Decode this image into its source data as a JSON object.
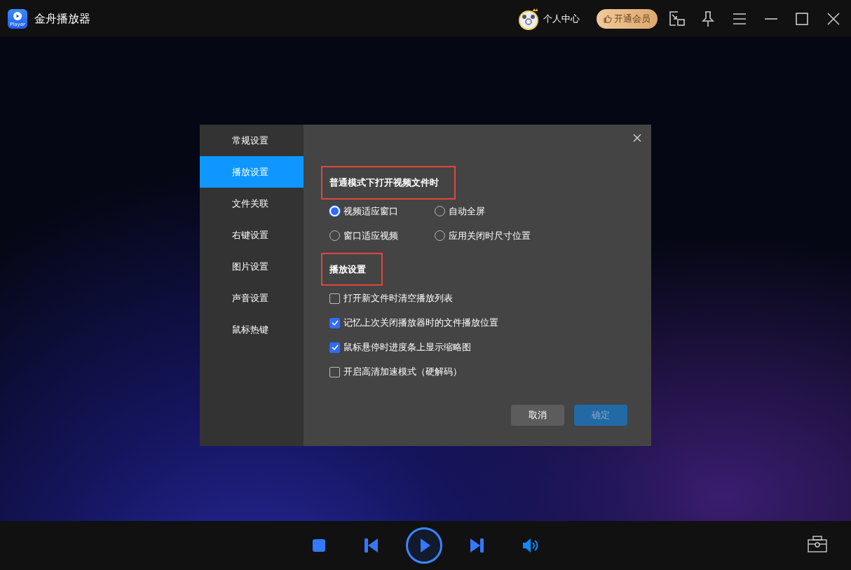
{
  "app": {
    "logo_text": "Player",
    "title": "金舟播放器"
  },
  "titlebar": {
    "user_label": "个人中心",
    "vip_button": "开通会员"
  },
  "settings": {
    "nav": [
      {
        "label": "常规设置",
        "selected": false
      },
      {
        "label": "播放设置",
        "selected": true
      },
      {
        "label": "文件关联",
        "selected": false
      },
      {
        "label": "右键设置",
        "selected": false
      },
      {
        "label": "图片设置",
        "selected": false
      },
      {
        "label": "声音设置",
        "selected": false
      },
      {
        "label": "鼠标热键",
        "selected": false
      }
    ],
    "sections": [
      {
        "title": "普通模式下打开视频文件时",
        "kind": "radio",
        "options": [
          {
            "label": "视频适应窗口",
            "selected": true
          },
          {
            "label": "自动全屏",
            "selected": false
          },
          {
            "label": "窗口适应视频",
            "selected": false
          },
          {
            "label": "应用关闭时尺寸位置",
            "selected": false
          }
        ]
      },
      {
        "title": "播放设置",
        "kind": "checkbox",
        "options": [
          {
            "label": "打开新文件时清空播放列表",
            "checked": false
          },
          {
            "label": "记忆上次关闭播放器时的文件播放位置",
            "checked": true
          },
          {
            "label": "鼠标悬停时进度条上显示缩略图",
            "checked": true
          },
          {
            "label": "开启高清加速模式（硬解码）",
            "checked": false
          }
        ]
      }
    ],
    "buttons": [
      {
        "label": "取消",
        "kind": "cancel",
        "disabled": false
      },
      {
        "label": "确定",
        "kind": "confirm",
        "disabled": true
      }
    ]
  }
}
